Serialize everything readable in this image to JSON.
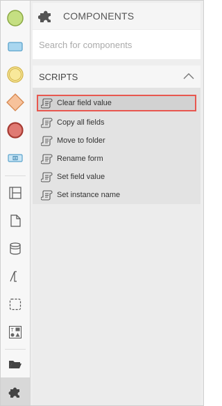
{
  "colors": {
    "accent_selection": "#e8574f",
    "event_start": "#b9d86a",
    "task": "#8ec9e8",
    "event_intermediate": "#f6e27c",
    "gateway": "#f4b182",
    "event_end": "#d9635c"
  },
  "toolbar": {
    "items": [
      {
        "name": "start-event-tool",
        "icon": "start-event-icon"
      },
      {
        "name": "task-tool",
        "icon": "task-icon"
      },
      {
        "name": "intermediate-event-tool",
        "icon": "intermediate-event-icon"
      },
      {
        "name": "gateway-tool",
        "icon": "gateway-icon"
      },
      {
        "name": "end-event-tool",
        "icon": "end-event-icon"
      },
      {
        "name": "subprocess-tool",
        "icon": "subprocess-icon"
      },
      {
        "name": "pool-lane-tool",
        "icon": "pool-lane-icon"
      },
      {
        "name": "document-tool",
        "icon": "document-icon"
      },
      {
        "name": "data-store-tool",
        "icon": "data-store-icon"
      },
      {
        "name": "annotation-tool",
        "icon": "annotation-icon"
      },
      {
        "name": "group-tool",
        "icon": "group-icon"
      },
      {
        "name": "form-tool",
        "icon": "form-icon"
      },
      {
        "name": "folder-tool",
        "icon": "folder-icon"
      },
      {
        "name": "components-tool",
        "icon": "puzzle-icon",
        "active": true
      }
    ]
  },
  "components": {
    "title": "COMPONENTS",
    "search_placeholder": "Search for components",
    "search_value": ""
  },
  "scripts": {
    "title": "SCRIPTS",
    "items": [
      {
        "label": "Clear field value",
        "selected": true
      },
      {
        "label": "Copy all fields"
      },
      {
        "label": "Move to folder"
      },
      {
        "label": "Rename form"
      },
      {
        "label": "Set field value"
      },
      {
        "label": "Set instance name"
      }
    ]
  }
}
